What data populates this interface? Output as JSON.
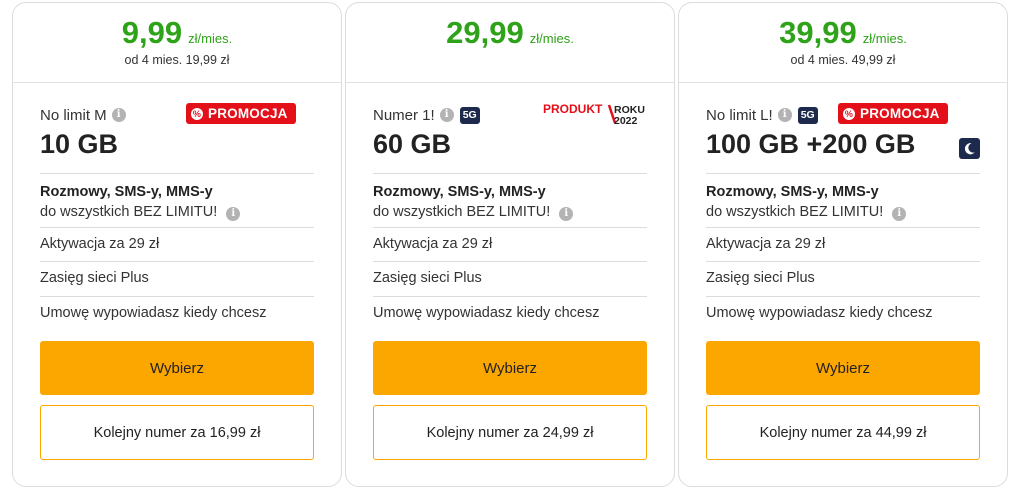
{
  "colors": {
    "price_green": "#2ea319",
    "accent_orange": "#fca600",
    "promo_red": "#e3101a",
    "badge_navy": "#1d2a4d"
  },
  "plans": [
    {
      "price": "9,99",
      "unit": "zł/mies.",
      "subprice": "od 4 mies. 19,99 zł",
      "name": "No limit M",
      "has_5g": false,
      "badge_5g": "",
      "promo_label": "PROMOCJA",
      "data": "10 GB",
      "calls_bold": "Rozmowy, SMS-y, MMS-y",
      "calls_rest": "do wszystkich BEZ LIMITU!",
      "activation": "Aktywacja za 29 zł",
      "network": "Zasięg sieci Plus",
      "contract": "Umowę wypowiadasz kiedy chcesz",
      "choose_label": "Wybierz",
      "next_number_label": "Kolejny numer za 16,99 zł"
    },
    {
      "price": "29,99",
      "unit": "zł/mies.",
      "subprice": "",
      "name": "Numer 1!",
      "has_5g": true,
      "badge_5g": "5G",
      "award_line1": "PRODUKT",
      "award_line2": "ROKU",
      "award_year": "2022",
      "data": "60 GB",
      "calls_bold": "Rozmowy, SMS-y, MMS-y",
      "calls_rest": "do wszystkich BEZ LIMITU!",
      "activation": "Aktywacja za 29 zł",
      "network": "Zasięg sieci Plus",
      "contract": "Umowę wypowiadasz kiedy chcesz",
      "choose_label": "Wybierz",
      "next_number_label": "Kolejny numer za 24,99 zł"
    },
    {
      "price": "39,99",
      "unit": "zł/mies.",
      "subprice": "od 4 mies. 49,99 zł",
      "name": "No limit L!",
      "has_5g": true,
      "badge_5g": "5G",
      "promo_label": "PROMOCJA",
      "data": "100 GB +200 GB",
      "calls_bold": "Rozmowy, SMS-y, MMS-y",
      "calls_rest": "do wszystkich BEZ LIMITU!",
      "activation": "Aktywacja za 29 zł",
      "network": "Zasięg sieci Plus",
      "contract": "Umowę wypowiadasz kiedy chcesz",
      "choose_label": "Wybierz",
      "next_number_label": "Kolejny numer za 44,99 zł"
    }
  ],
  "icons": {
    "info": "info-icon",
    "promo": "percent-icon",
    "moon": "moon-icon"
  }
}
